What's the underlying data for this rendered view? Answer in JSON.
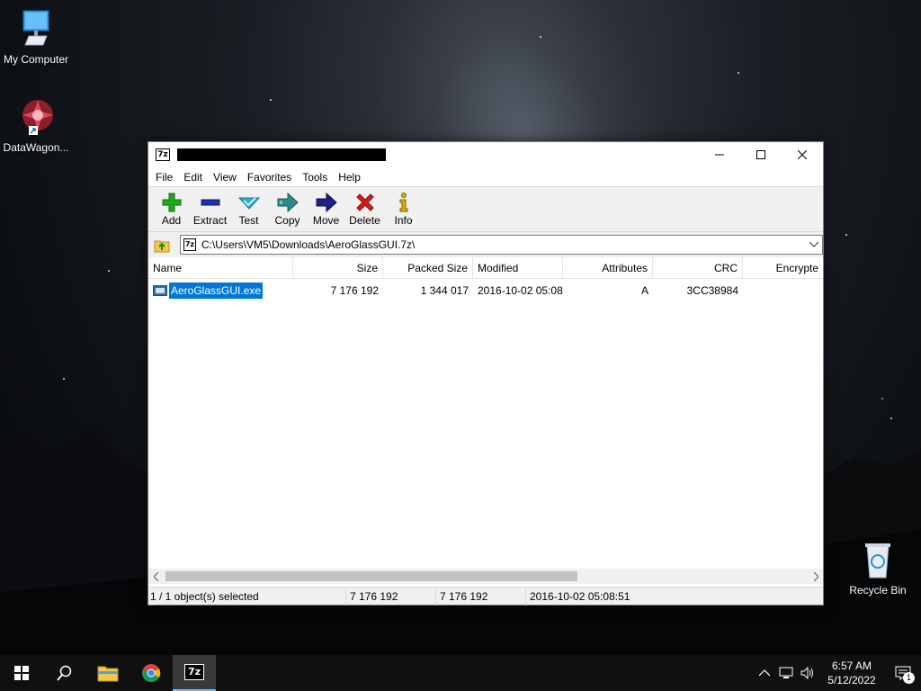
{
  "desktop": {
    "icons": [
      {
        "label": "My Computer",
        "icon": "computer-icon"
      },
      {
        "label": "DataWagon...",
        "icon": "datawagon-shortcut-icon"
      },
      {
        "label": "Recycle Bin",
        "icon": "recycle-bin-icon"
      }
    ]
  },
  "window": {
    "app_icon_text": "7z",
    "title": "",
    "menu": [
      "File",
      "Edit",
      "View",
      "Favorites",
      "Tools",
      "Help"
    ],
    "toolbar": [
      {
        "label": "Add",
        "icon": "add-icon",
        "color": "#1fa81f"
      },
      {
        "label": "Extract",
        "icon": "extract-icon",
        "color": "#1e2fb5"
      },
      {
        "label": "Test",
        "icon": "test-icon",
        "color": "#2bb3c9"
      },
      {
        "label": "Copy",
        "icon": "copy-icon",
        "color": "#2e8b8b"
      },
      {
        "label": "Move",
        "icon": "move-icon",
        "color": "#1c1f8c"
      },
      {
        "label": "Delete",
        "icon": "delete-icon",
        "color": "#d91a1a"
      },
      {
        "label": "Info",
        "icon": "info-icon",
        "color": "#d8b400"
      }
    ],
    "address": "C:\\Users\\VM5\\Downloads\\AeroGlassGUI.7z\\",
    "columns": [
      "Name",
      "Size",
      "Packed Size",
      "Modified",
      "Attributes",
      "CRC",
      "Encrypte"
    ],
    "rows": [
      {
        "name": "AeroGlassGUI.exe",
        "size": "7 176 192",
        "packed": "1 344 017",
        "modified": "2016-10-02 05:08",
        "attributes": "A",
        "crc": "3CC38984",
        "encrypted": ""
      }
    ],
    "status": {
      "selected": "1 / 1 object(s) selected",
      "size": "7 176 192",
      "packed": "7 176 192",
      "modified": "2016-10-02 05:08:51"
    }
  },
  "taskbar": {
    "apps": [
      {
        "name": "start",
        "icon": "windows-logo-icon"
      },
      {
        "name": "search",
        "icon": "search-icon"
      },
      {
        "name": "file-explorer",
        "icon": "folder-icon"
      },
      {
        "name": "chrome",
        "icon": "chrome-icon"
      },
      {
        "name": "7-zip",
        "icon": "7zip-icon",
        "text": "7z",
        "active": true
      }
    ],
    "clock_time": "6:57 AM",
    "clock_date": "5/12/2022",
    "notification_count": "1"
  }
}
